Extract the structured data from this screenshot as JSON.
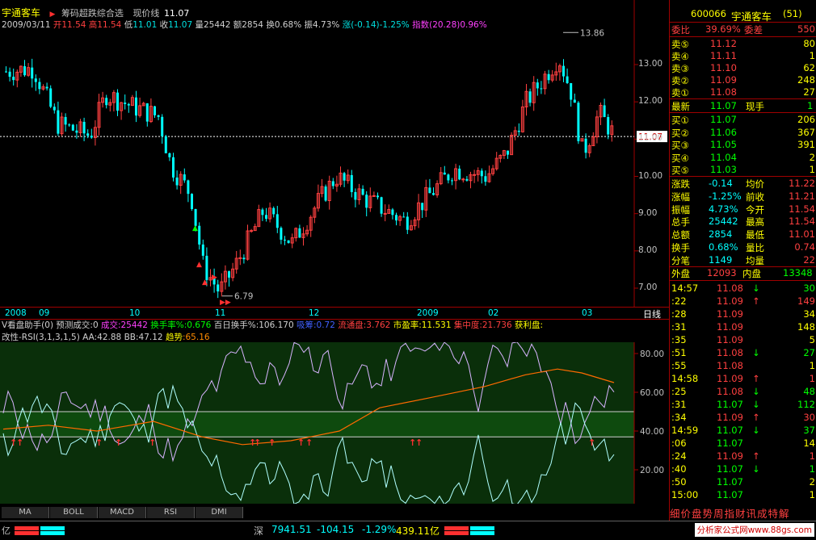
{
  "header": {
    "stock_name": "宇通客车",
    "formula_name": "筹码超跌综合选",
    "line_label": "现价线",
    "line_value": "11.07"
  },
  "quote_line": {
    "date": "2009/03/11",
    "open_label": "开",
    "open": "11.54",
    "high_label": "高",
    "high": "11.54",
    "low_label": "低",
    "low": "11.01",
    "close_label": "收",
    "close": "11.07",
    "vol_label": "量",
    "vol": "25442",
    "amt_label": "额",
    "amt": "2854",
    "turn_label": "换",
    "turn": "0.68%",
    "amp_label": "振",
    "amp": "4.73%",
    "chg_label": "涨",
    "chg": "(-0.14)-1.25%",
    "index_label": "指数",
    "index": "(20.28)0.96%"
  },
  "price_axis": {
    "labels": [
      "13.00",
      "12.00",
      "11.00",
      "10.00",
      "9.00",
      "8.00",
      "7.00"
    ],
    "current": "11.07"
  },
  "main_chart_annotations": {
    "high": "13.86",
    "low": "6.79"
  },
  "date_axis": {
    "ticks": [
      "2008",
      "09",
      "10",
      "11",
      "12",
      "2009",
      "02",
      "03"
    ],
    "period": "日线"
  },
  "indicator_line": {
    "title": "V看盘助手(0)",
    "pred_label": "预测成交",
    "pred": ":0",
    "vol_label": "成交",
    "vol": ":25442",
    "turn_label": "换手率%",
    "turn": ":0.676",
    "turn100_label": "百日换手%",
    "turn100": ":106.170",
    "ratio_label": "吸筹",
    "ratio": ":0.72",
    "float_label": "流通盘",
    "float": ":3.762",
    "pe_label": "市盈率",
    "pe": ":11.531",
    "conc_label": "集中度",
    "conc": ":21.736",
    "profit_label": "获利盘",
    "profit": ":"
  },
  "rsi": {
    "title": "改性-RSI(3,1,3,1,5)",
    "aa_label": "AA",
    "aa": ":42.88",
    "bb_label": "BB",
    "bb": ":47.12",
    "trend_label": "趋势",
    "trend": ":65.16",
    "axis": [
      "80.00",
      "60.00",
      "40.00",
      "20.00"
    ]
  },
  "tabs": [
    "MA",
    "BOLL",
    "MACD",
    "RSI",
    "DMI"
  ],
  "status": {
    "left_label": "亿",
    "market": "深",
    "index": "7941.51",
    "change": "-104.15",
    "pct": "-1.29%",
    "amount": "439.11亿",
    "site": "分析家公式网www.88gs.com"
  },
  "panel": {
    "code": "600066",
    "name": "宇通客车",
    "count": "(51)",
    "wb_label": "委比",
    "wb": "39.69%",
    "wc_label": "委差",
    "wc": "550",
    "asks": [
      {
        "label": "卖⑤",
        "price": "11.12",
        "vol": "80"
      },
      {
        "label": "卖④",
        "price": "11.11",
        "vol": "1"
      },
      {
        "label": "卖③",
        "price": "11.10",
        "vol": "62"
      },
      {
        "label": "卖②",
        "price": "11.09",
        "vol": "248"
      },
      {
        "label": "卖①",
        "price": "11.08",
        "vol": "27"
      }
    ],
    "last_label": "最新",
    "last": "11.07",
    "turn_label": "现手",
    "turn": "1",
    "bids": [
      {
        "label": "买①",
        "price": "11.07",
        "vol": "206"
      },
      {
        "label": "买②",
        "price": "11.06",
        "vol": "367"
      },
      {
        "label": "买③",
        "price": "11.05",
        "vol": "391"
      },
      {
        "label": "买④",
        "price": "11.04",
        "vol": "2"
      },
      {
        "label": "买⑤",
        "price": "11.03",
        "vol": "1"
      }
    ],
    "stats": [
      {
        "l1": "涨跌",
        "v1": "-0.14",
        "l2": "均价",
        "v2": "11.22"
      },
      {
        "l1": "涨幅",
        "v1": "-1.25%",
        "l2": "前收",
        "v2": "11.21"
      },
      {
        "l1": "振幅",
        "v1": "4.73%",
        "l2": "今开",
        "v2": "11.54"
      },
      {
        "l1": "总手",
        "v1": "25442",
        "l2": "最高",
        "v2": "11.54"
      },
      {
        "l1": "总额",
        "v1": "2854",
        "l2": "最低",
        "v2": "11.01"
      },
      {
        "l1": "换手",
        "v1": "0.68%",
        "l2": "量比",
        "v2": "0.74"
      },
      {
        "l1": "分笔",
        "v1": "1149",
        "l2": "均量",
        "v2": "22"
      }
    ],
    "outer_label": "外盘",
    "outer": "12093",
    "inner_label": "内盘",
    "inner": "13348",
    "ticks": [
      {
        "t": "14:57",
        "p": "11.08",
        "d": "↓",
        "v": "30"
      },
      {
        "t": ":22",
        "p": "11.09",
        "d": "↑",
        "v": "149"
      },
      {
        "t": ":28",
        "p": "11.09",
        "d": "",
        "v": "34"
      },
      {
        "t": ":31",
        "p": "11.09",
        "d": "",
        "v": "148"
      },
      {
        "t": ":35",
        "p": "11.09",
        "d": "",
        "v": "5"
      },
      {
        "t": ":51",
        "p": "11.08",
        "d": "↓",
        "v": "27"
      },
      {
        "t": ":55",
        "p": "11.08",
        "d": "",
        "v": "1"
      },
      {
        "t": "14:58",
        "p": "11.09",
        "d": "↑",
        "v": "1"
      },
      {
        "t": ":25",
        "p": "11.08",
        "d": "↓",
        "v": "48"
      },
      {
        "t": ":31",
        "p": "11.07",
        "d": "↓",
        "v": "112"
      },
      {
        "t": ":34",
        "p": "11.09",
        "d": "↑",
        "v": "30"
      },
      {
        "t": "14:59",
        "p": "11.07",
        "d": "↓",
        "v": "37"
      },
      {
        "t": ":06",
        "p": "11.07",
        "d": "",
        "v": "14"
      },
      {
        "t": ":24",
        "p": "11.09",
        "d": "↑",
        "v": "1"
      },
      {
        "t": ":40",
        "p": "11.07",
        "d": "↓",
        "v": "1"
      },
      {
        "t": ":50",
        "p": "11.07",
        "d": "",
        "v": "2"
      },
      {
        "t": "15:00",
        "p": "11.07",
        "d": "",
        "v": "1"
      }
    ],
    "bottom_tabs": "细价盘势周指财讯成特解"
  },
  "colors": {
    "up": "#ff4040",
    "down": "#00ffff",
    "band": "#0e4a0e",
    "rsi_bg": "#0a2f0a",
    "trend": "#ff6a00"
  }
}
